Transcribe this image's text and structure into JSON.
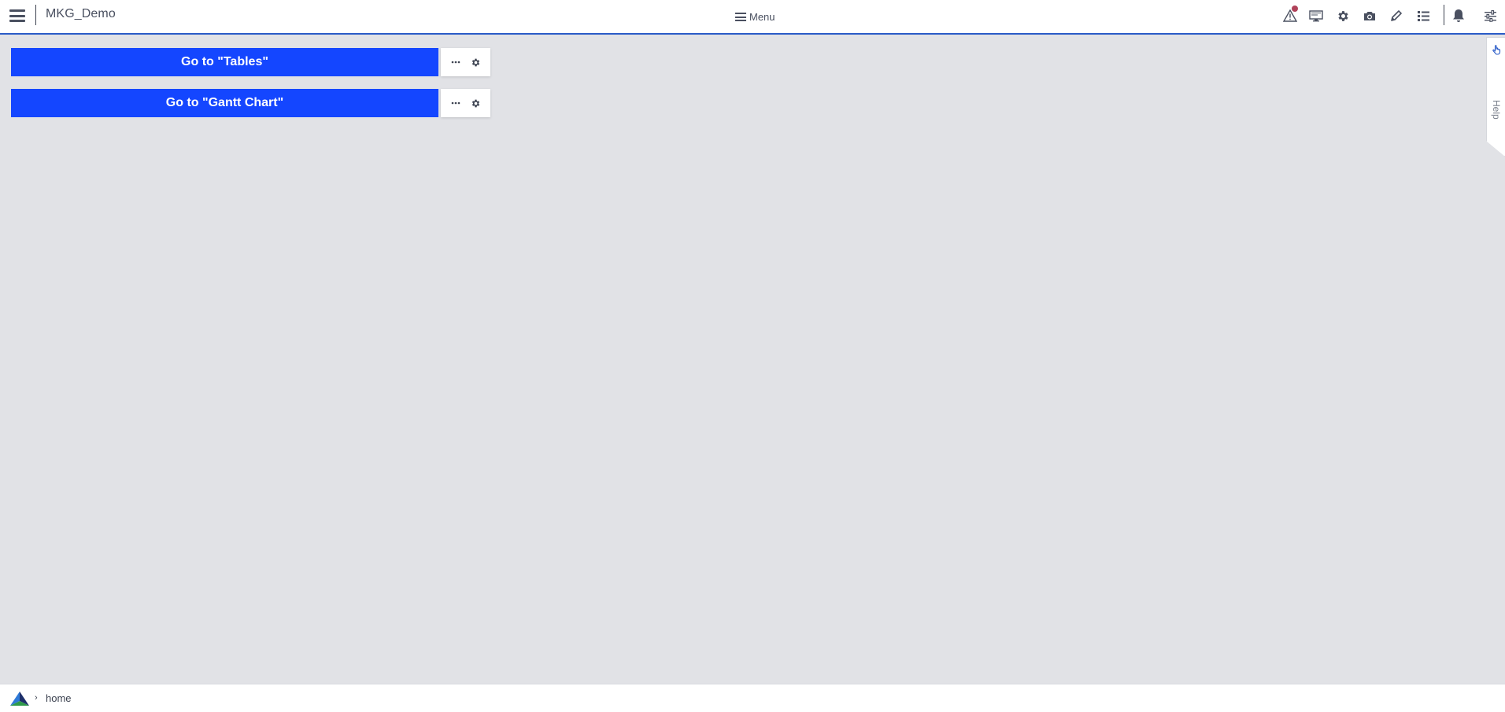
{
  "app": {
    "title": "MKG_Demo"
  },
  "header": {
    "menu_label": "Menu",
    "icons": [
      "alerts-icon",
      "screen-icon",
      "settings-icon",
      "camera-icon",
      "edit-icon",
      "list-icon",
      "notifications-icon",
      "sliders-icon"
    ],
    "alert_dot_color": "#b0425a",
    "border_color": "#2a5bc7"
  },
  "main": {
    "buttons": [
      {
        "label": "Go to \"Tables\""
      },
      {
        "label": "Go to \"Gantt Chart\""
      }
    ],
    "button_color": "#1446ff"
  },
  "help": {
    "label": "Help"
  },
  "footer": {
    "breadcrumb": [
      "home"
    ]
  }
}
